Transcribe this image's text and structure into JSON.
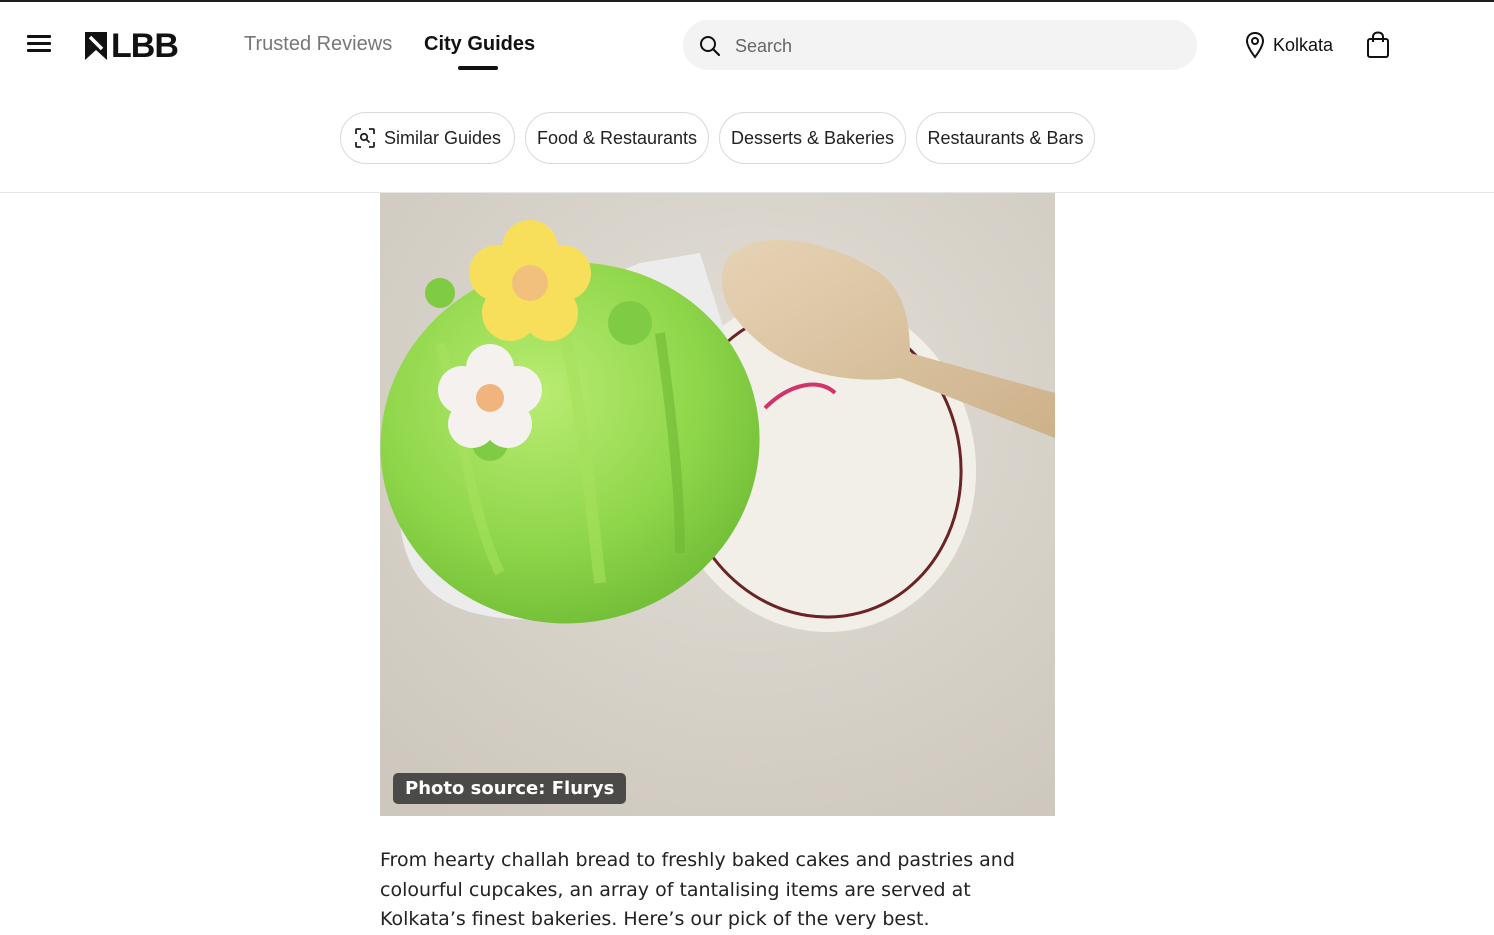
{
  "header": {
    "logo_text": "LBB",
    "nav": [
      {
        "label": "Trusted Reviews",
        "active": false
      },
      {
        "label": "City Guides",
        "active": true
      }
    ],
    "search": {
      "placeholder": "Search",
      "value": ""
    },
    "location": "Kolkata",
    "icons": [
      "menu-icon",
      "search-icon",
      "location-pin-icon",
      "shopping-bag-icon"
    ]
  },
  "chips": [
    {
      "label": "Similar Guides",
      "icon": "scan-search-icon"
    },
    {
      "label": "Food & Restaurants"
    },
    {
      "label": "Desserts & Bakeries"
    },
    {
      "label": "Restaurants & Bars"
    }
  ],
  "photo": {
    "caption_prefix": "Photo source:",
    "caption_source": "Flurys"
  },
  "article": {
    "intro": "From hearty challah bread to freshly baked cakes and pastries and colourful cupcakes, an array of tantalising items are served at Kolkata’s finest bakeries. Here’s our pick of the very best."
  },
  "colors": {
    "accent": "#111111",
    "chip_border": "#d9d9d9",
    "search_bg": "#f3f3f4",
    "muted_text": "#777777"
  }
}
